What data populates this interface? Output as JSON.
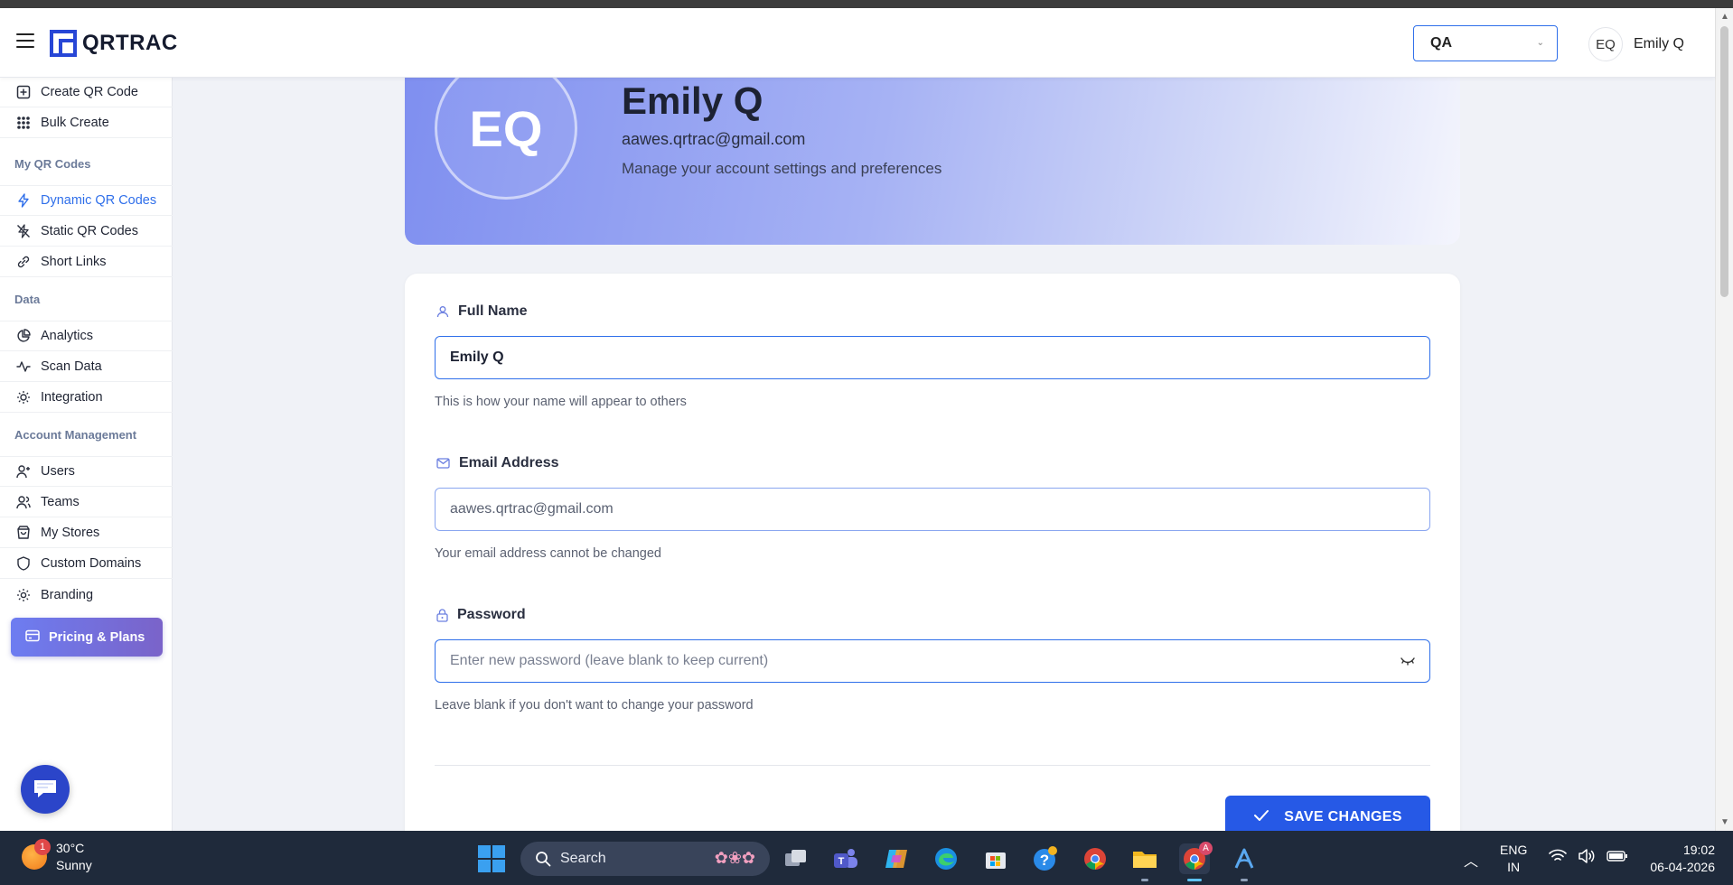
{
  "app": {
    "name": "QRTRAC"
  },
  "header": {
    "environment": "QA",
    "user_initials": "EQ",
    "user_name": "Emily Q"
  },
  "sidebar": {
    "top_items": [
      {
        "label": "Create QR Code",
        "icon": "plus-square-icon"
      },
      {
        "label": "Bulk Create",
        "icon": "grid-dots-icon"
      }
    ],
    "sections": [
      {
        "title": "My QR Codes",
        "items": [
          {
            "label": "Dynamic QR Codes",
            "icon": "lightning-icon",
            "active": true
          },
          {
            "label": "Static QR Codes",
            "icon": "zap-off-icon"
          },
          {
            "label": "Short Links",
            "icon": "link-icon"
          }
        ]
      },
      {
        "title": "Data",
        "items": [
          {
            "label": "Analytics",
            "icon": "pie-chart-icon"
          },
          {
            "label": "Scan Data",
            "icon": "activity-icon"
          },
          {
            "label": "Integration",
            "icon": "lightbulb-icon"
          }
        ]
      },
      {
        "title": "Account Management",
        "items": [
          {
            "label": "Users",
            "icon": "user-plus-icon"
          },
          {
            "label": "Teams",
            "icon": "users-icon"
          },
          {
            "label": "My Stores",
            "icon": "shopping-bag-icon"
          },
          {
            "label": "Custom Domains",
            "icon": "shield-icon"
          },
          {
            "label": "Branding",
            "icon": "sun-icon"
          }
        ]
      }
    ],
    "pricing_label": "Pricing & Plans"
  },
  "profile": {
    "initials": "EQ",
    "name": "Emily Q",
    "email": "aawes.qrtrac@gmail.com",
    "subtitle": "Manage your account settings and preferences"
  },
  "form": {
    "full_name": {
      "label": "Full Name",
      "value": "Emily Q",
      "help": "This is how your name will appear to others"
    },
    "email": {
      "label": "Email Address",
      "value": "aawes.qrtrac@gmail.com",
      "help": "Your email address cannot be changed"
    },
    "password": {
      "label": "Password",
      "placeholder": "Enter new password (leave blank to keep current)",
      "help": "Leave blank if you don't want to change your password"
    },
    "save_label": "SAVE CHANGES"
  },
  "taskbar": {
    "weather_temp": "30°C",
    "weather_desc": "Sunny",
    "weather_badge": "1",
    "search_label": "Search",
    "lang_top": "ENG",
    "lang_bottom": "IN",
    "time": "19:02",
    "date": "06-04-2026",
    "chrome_badge": "A"
  },
  "colors": {
    "accent": "#2f6fea",
    "brand": "#2746d6",
    "save_button": "#2659e6",
    "pricing_gradient_start": "#6d7df1",
    "pricing_gradient_end": "#7a63c9",
    "banner_start": "#7f8ff0"
  }
}
